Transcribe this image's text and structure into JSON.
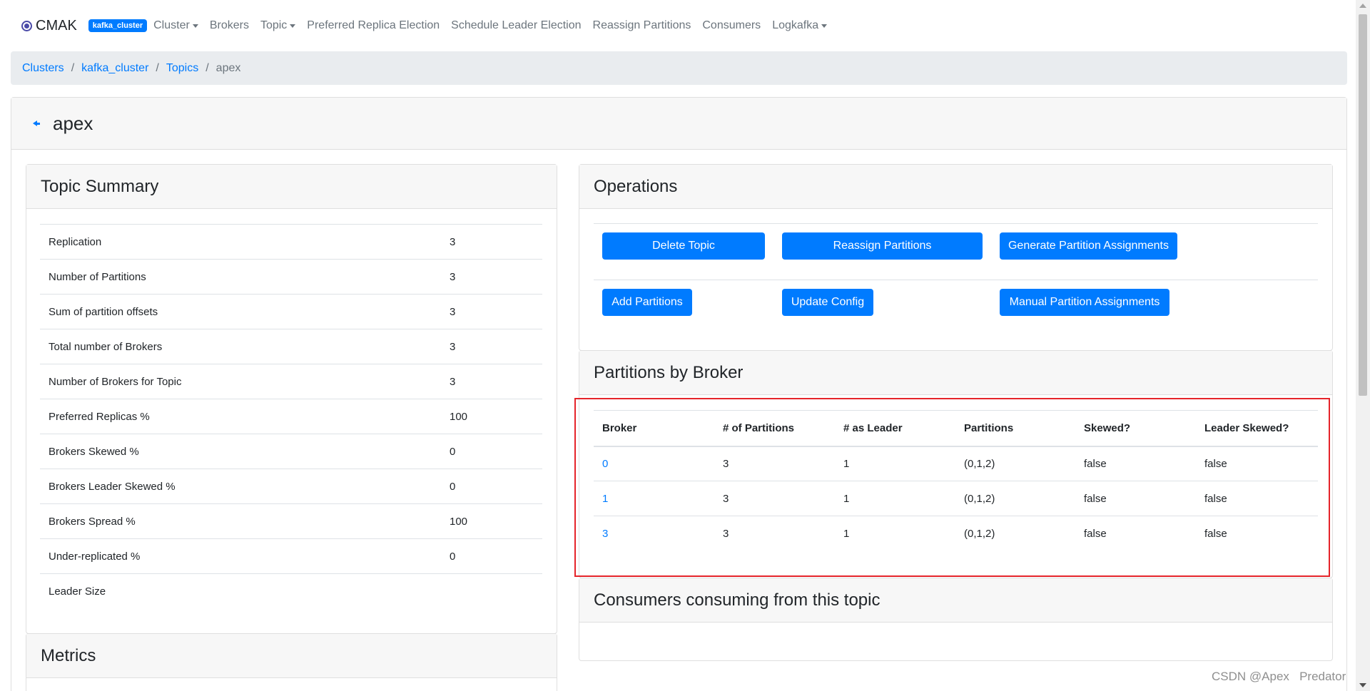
{
  "navbar": {
    "brand": "CMAK",
    "cluster_badge": "kafka_cluster",
    "items": [
      {
        "label": "Cluster",
        "dropdown": true
      },
      {
        "label": "Brokers",
        "dropdown": false
      },
      {
        "label": "Topic",
        "dropdown": true
      },
      {
        "label": "Preferred Replica Election",
        "dropdown": false
      },
      {
        "label": "Schedule Leader Election",
        "dropdown": false
      },
      {
        "label": "Reassign Partitions",
        "dropdown": false
      },
      {
        "label": "Consumers",
        "dropdown": false
      },
      {
        "label": "Logkafka",
        "dropdown": true
      }
    ]
  },
  "breadcrumb": {
    "clusters": "Clusters",
    "cluster": "kafka_cluster",
    "topics": "Topics",
    "current": "apex",
    "separator": "/"
  },
  "topic": {
    "name": "apex"
  },
  "summary": {
    "title": "Topic Summary",
    "rows": [
      {
        "label": "Replication",
        "value": "3"
      },
      {
        "label": "Number of Partitions",
        "value": "3"
      },
      {
        "label": "Sum of partition offsets",
        "value": "3"
      },
      {
        "label": "Total number of Brokers",
        "value": "3"
      },
      {
        "label": "Number of Brokers for Topic",
        "value": "3"
      },
      {
        "label": "Preferred Replicas %",
        "value": "100"
      },
      {
        "label": "Brokers Skewed %",
        "value": "0"
      },
      {
        "label": "Brokers Leader Skewed %",
        "value": "0"
      },
      {
        "label": "Brokers Spread %",
        "value": "100"
      },
      {
        "label": "Under-replicated %",
        "value": "0"
      },
      {
        "label": "Leader Size",
        "value": ""
      }
    ]
  },
  "metrics": {
    "title": "Metrics"
  },
  "operations": {
    "title": "Operations",
    "delete_topic": "Delete Topic",
    "reassign_partitions": "Reassign Partitions",
    "generate_assignments": "Generate Partition Assignments",
    "add_partitions": "Add Partitions",
    "update_config": "Update Config",
    "manual_assignments": "Manual Partition Assignments"
  },
  "partitions_by_broker": {
    "title": "Partitions by Broker",
    "columns": [
      "Broker",
      "# of Partitions",
      "# as Leader",
      "Partitions",
      "Skewed?",
      "Leader Skewed?"
    ],
    "rows": [
      {
        "broker": "0",
        "num_partitions": "3",
        "as_leader": "1",
        "partitions": "(0,1,2)",
        "skewed": "false",
        "leader_skewed": "false"
      },
      {
        "broker": "1",
        "num_partitions": "3",
        "as_leader": "1",
        "partitions": "(0,1,2)",
        "skewed": "false",
        "leader_skewed": "false"
      },
      {
        "broker": "3",
        "num_partitions": "3",
        "as_leader": "1",
        "partitions": "(0,1,2)",
        "skewed": "false",
        "leader_skewed": "false"
      }
    ]
  },
  "consumers": {
    "title": "Consumers consuming from this topic"
  },
  "watermark": "CSDN @Apex   Predator",
  "colors": {
    "accent": "#007bff",
    "highlight": "#e5242a",
    "header_bg": "#f7f7f7",
    "breadcrumb_bg": "#e9ecef"
  }
}
